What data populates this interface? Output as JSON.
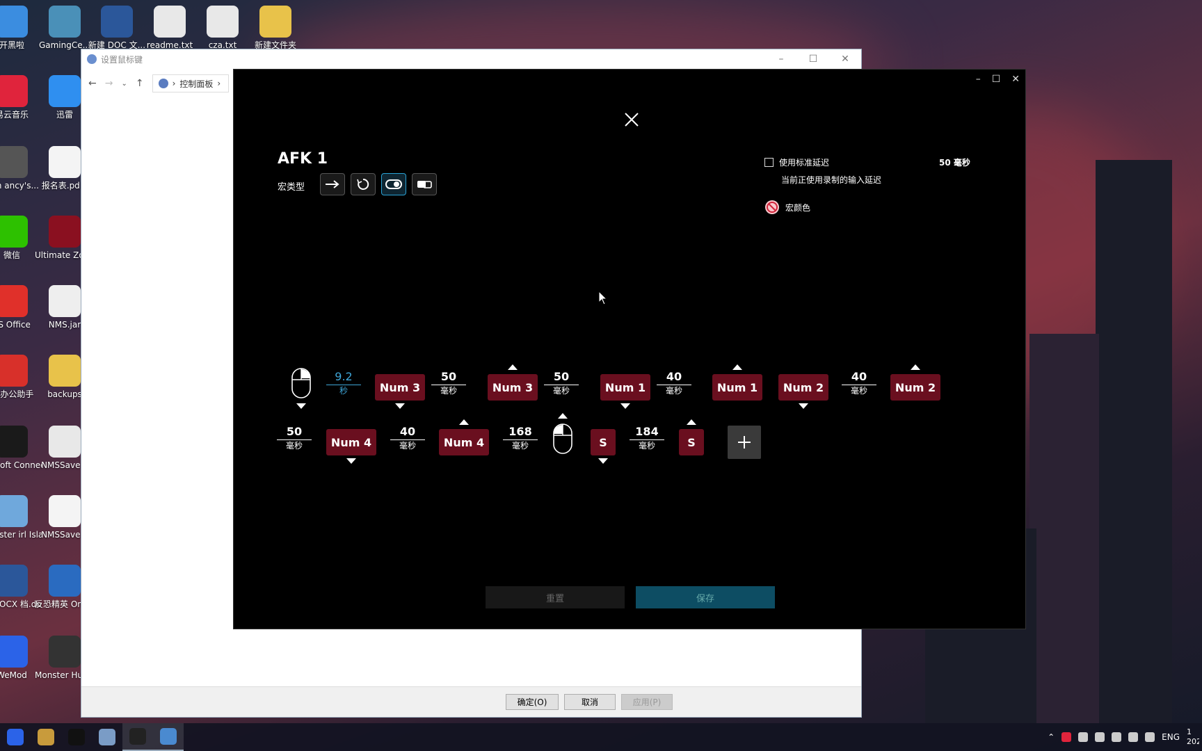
{
  "desktop": {
    "icons": [
      {
        "label": "开黑啦",
        "icon": "chat-bubble-icon",
        "color": "#3b8de0"
      },
      {
        "label": "GamingCe...",
        "icon": "gaming-center-icon",
        "color": "#4a90b8"
      },
      {
        "label": "新建 DOC 文...",
        "icon": "word-doc-icon",
        "color": "#2b579a"
      },
      {
        "label": "readme.txt",
        "icon": "text-file-icon",
        "color": "#e8e8e8"
      },
      {
        "label": "cza.txt",
        "icon": "text-file-icon",
        "color": "#e8e8e8"
      },
      {
        "label": "新建文件夹",
        "icon": "folder-icon",
        "color": "#e8c24a"
      },
      {
        "label": "易云音乐",
        "icon": "netease-music-icon",
        "color": "#e0243c"
      },
      {
        "label": "迅雷",
        "icon": "thunder-icon",
        "color": "#2f8ff0"
      },
      {
        "label": "Tom ancy's...",
        "icon": "game-skull-icon",
        "color": "#555"
      },
      {
        "label": "报名表.pd...",
        "icon": "pdf-icon",
        "color": "#f4f4f4"
      },
      {
        "label": "微信",
        "icon": "wechat-icon",
        "color": "#2dc100"
      },
      {
        "label": "Ultimate Zombi...",
        "icon": "zombie-z-icon",
        "color": "#8a1020"
      },
      {
        "label": "PS Office",
        "icon": "wps-icon",
        "color": "#e0302a"
      },
      {
        "label": "NMS.jar",
        "icon": "java-icon",
        "color": "#eee"
      },
      {
        "label": "PS办公助手",
        "icon": "wps-cloud-icon",
        "color": "#d8302a"
      },
      {
        "label": "backups",
        "icon": "folder-icon",
        "color": "#e8c24a"
      },
      {
        "label": "Ubisoft Connect",
        "icon": "ubisoft-icon",
        "color": "#1a1a1a"
      },
      {
        "label": "NMSSave...",
        "icon": "text-file-icon",
        "color": "#e8e8e8"
      },
      {
        "label": "Monster irl Isla...",
        "icon": "cloud-game-icon",
        "color": "#6fa8dc"
      },
      {
        "label": "NMSSave...",
        "icon": "blank-file-icon",
        "color": "#f4f4f4"
      },
      {
        "label": "建 DOCX 档.docx",
        "icon": "word-doc-icon",
        "color": "#2b579a"
      },
      {
        "label": "反恐精英 Online",
        "icon": "cso-icon",
        "color": "#2a6bc0"
      },
      {
        "label": "WeMod",
        "icon": "wemod-icon",
        "color": "#2b63e8"
      },
      {
        "label": "Monster Hunter...",
        "icon": "monster-hunter-icon",
        "color": "#333"
      }
    ]
  },
  "explorer": {
    "title": "设置鼠标键",
    "breadcrumb": "控制面板",
    "buttons": {
      "ok": "确定(O)",
      "cancel": "取消",
      "apply": "应用(P)"
    }
  },
  "ghub": {
    "title": "AFK 1",
    "macro_type_label": "宏类型",
    "macro_types": [
      {
        "icon": "arrow-right-icon",
        "active": false
      },
      {
        "icon": "repeat-icon",
        "active": false
      },
      {
        "icon": "toggle-icon",
        "active": true
      },
      {
        "icon": "sequence-icon",
        "active": false
      }
    ],
    "standard_delay_label": "使用标准延迟",
    "standard_delay_value": "50 毫秒",
    "recorded_delay_note": "当前正使用录制的输入延迟",
    "macro_color_label": "宏颜色",
    "row1": {
      "first_delay": {
        "value": "9.2",
        "unit": "秒"
      },
      "items": [
        {
          "kind": "key",
          "label": "Num 3",
          "dir": "down"
        },
        {
          "kind": "delay",
          "value": "50",
          "unit": "毫秒"
        },
        {
          "kind": "key",
          "label": "Num 3",
          "dir": "up"
        },
        {
          "kind": "delay",
          "value": "50",
          "unit": "毫秒"
        },
        {
          "kind": "key",
          "label": "Num 1",
          "dir": "down"
        },
        {
          "kind": "delay",
          "value": "40",
          "unit": "毫秒"
        },
        {
          "kind": "key",
          "label": "Num 1",
          "dir": "up"
        },
        {
          "kind": "key",
          "label": "Num 2",
          "dir": "down"
        },
        {
          "kind": "delay",
          "value": "40",
          "unit": "毫秒"
        },
        {
          "kind": "key",
          "label": "Num 2",
          "dir": "up"
        }
      ]
    },
    "row2": {
      "items": [
        {
          "kind": "delay",
          "value": "50",
          "unit": "毫秒"
        },
        {
          "kind": "key",
          "label": "Num 4",
          "dir": "down"
        },
        {
          "kind": "delay",
          "value": "40",
          "unit": "毫秒"
        },
        {
          "kind": "key",
          "label": "Num 4",
          "dir": "up"
        },
        {
          "kind": "delay",
          "value": "168",
          "unit": "毫秒"
        },
        {
          "kind": "key",
          "label": "S",
          "dir": "down"
        },
        {
          "kind": "delay",
          "value": "184",
          "unit": "毫秒"
        },
        {
          "kind": "key",
          "label": "S",
          "dir": "up"
        }
      ]
    },
    "reset_label": "重置",
    "save_label": "保存"
  },
  "taskbar": {
    "apps": [
      {
        "icon": "wemod-icon",
        "color": "#2b63e8"
      },
      {
        "icon": "cso-icon",
        "color": "#c89b3c"
      },
      {
        "icon": "qq-icon",
        "color": "#111"
      },
      {
        "icon": "control-panel-icon",
        "color": "#7a9cc6"
      },
      {
        "icon": "logitech-ghub-icon",
        "color": "#222",
        "active": true
      },
      {
        "icon": "mouse-settings-icon",
        "color": "#4a8ad0",
        "active": true
      }
    ],
    "language": "ENG",
    "clock_partial": "1",
    "date_partial": "202"
  }
}
